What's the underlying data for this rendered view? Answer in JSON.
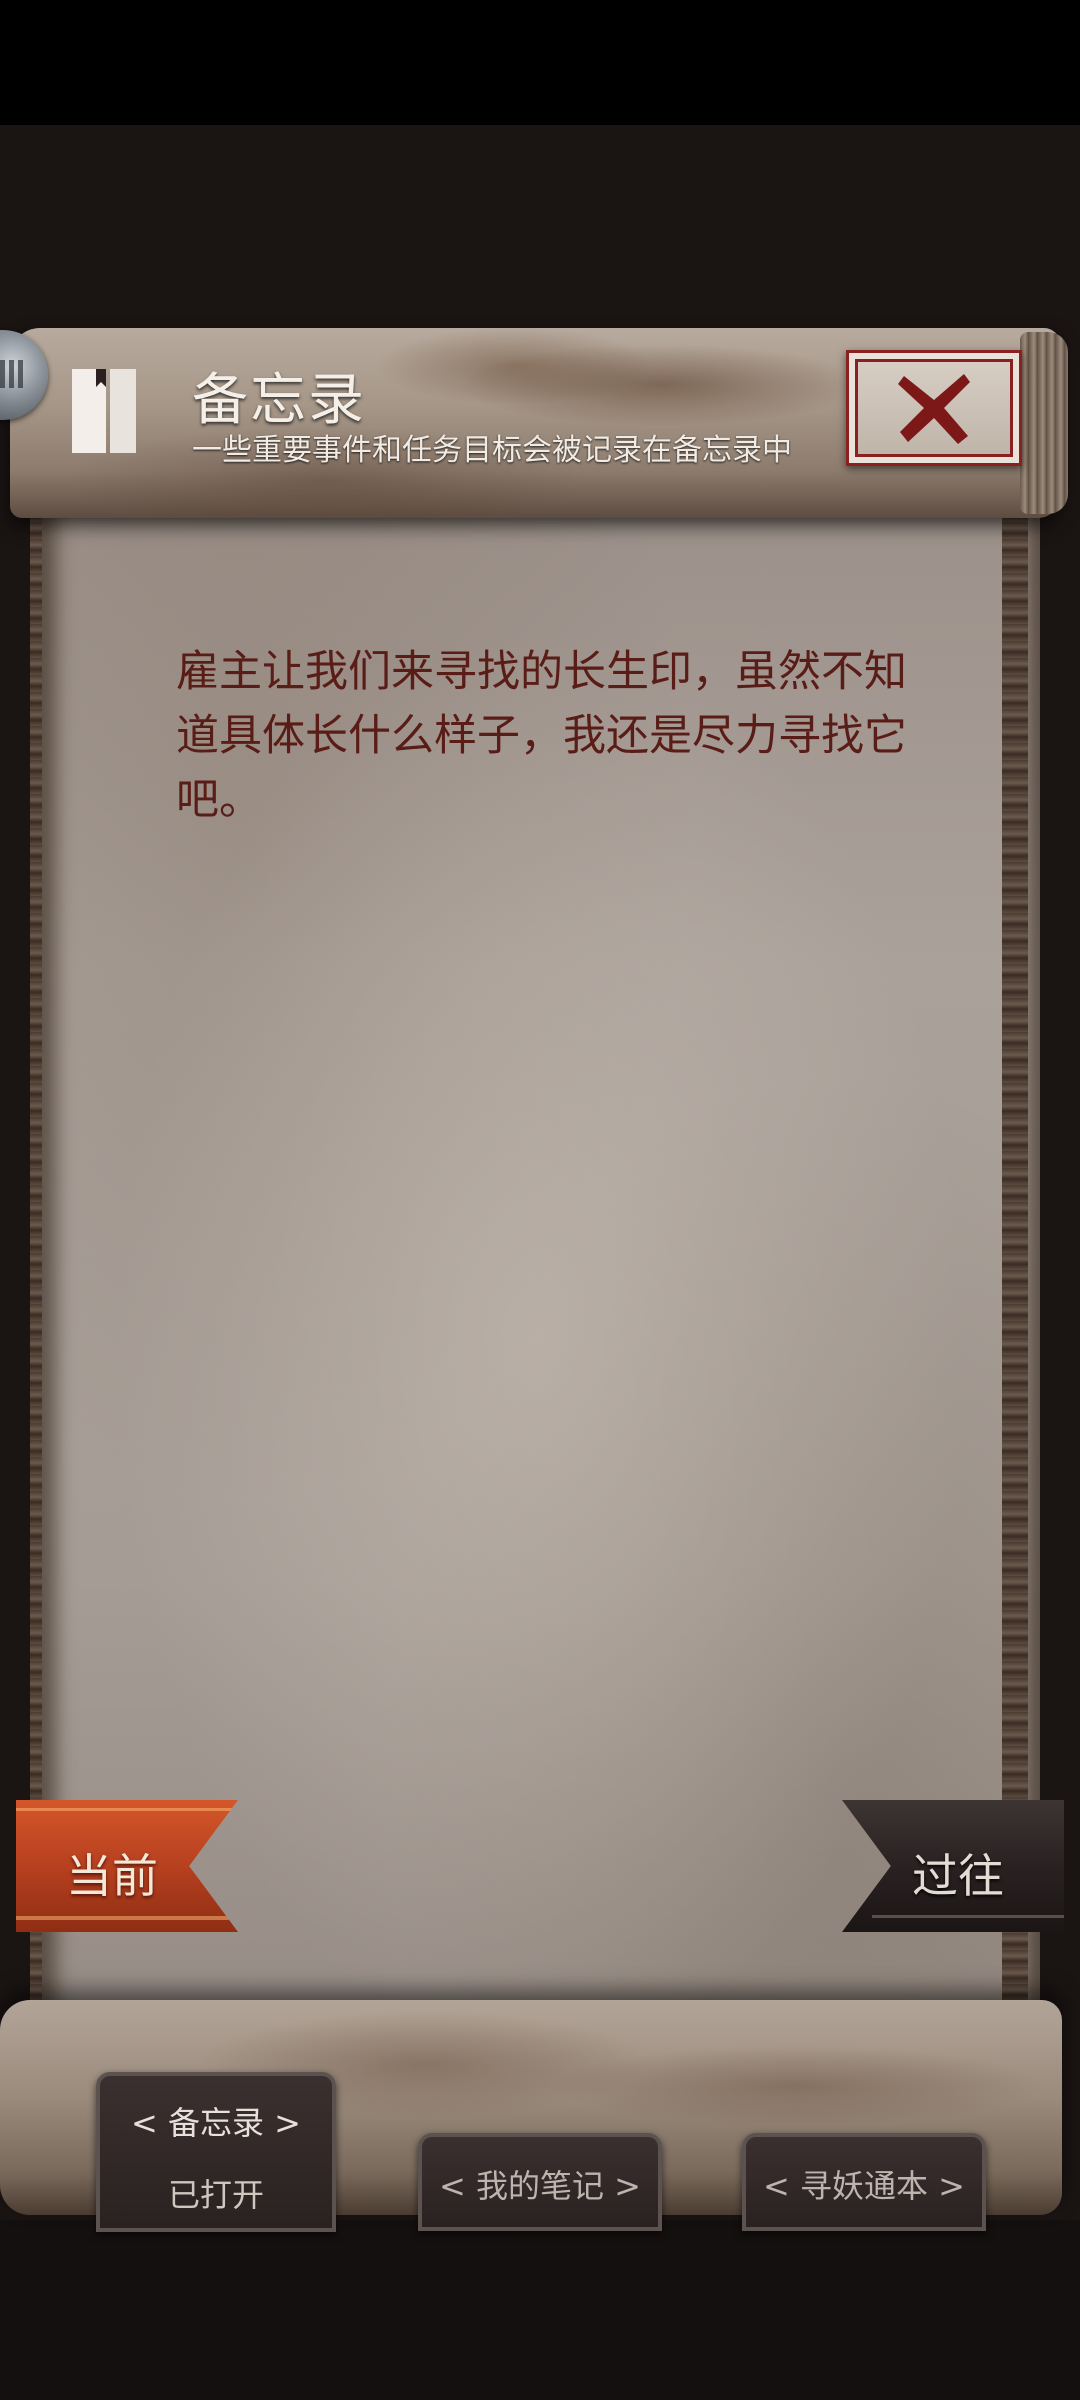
{
  "header": {
    "title": "备忘录",
    "subtitle": "一些重要事件和任务目标会被记录在备忘录中"
  },
  "icons": {
    "book": "book-icon",
    "close": "close-x-icon",
    "knob": "roller-knob"
  },
  "memo": {
    "text": "雇主让我们来寻找的长生印，虽然不知道具体长什么样子，我还是尽力寻找它吧。"
  },
  "banners": {
    "current": "当前",
    "past": "过往"
  },
  "tabs": [
    {
      "label": "< 备忘录 >",
      "status": "已打开",
      "active": true
    },
    {
      "label": "< 我的笔记 >",
      "active": false
    },
    {
      "label": "< 寻妖通本 >",
      "active": false
    }
  ],
  "colors": {
    "memo_text": "#5a1c16",
    "current_banner": "#b7401f",
    "past_banner": "#2a2222",
    "close_accent": "#8a2020"
  }
}
